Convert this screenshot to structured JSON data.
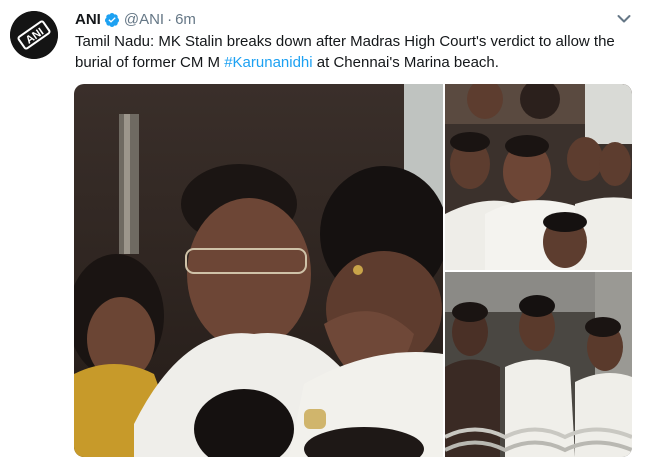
{
  "tweet": {
    "author_name": "ANI",
    "handle": "@ANI",
    "separator": "·",
    "time": "6m",
    "text_prefix": "Tamil Nadu: MK Stalin breaks down after Madras High Court's verdict to allow the burial of former CM M ",
    "hashtag": "#Karunanidhi",
    "text_suffix": " at Chennai's Marina beach."
  },
  "avatar": {
    "logo_text": "ANI"
  },
  "colors": {
    "text": "#14171a",
    "muted": "#657786",
    "link": "#1da1f2",
    "verified": "#1da1f2"
  },
  "icons": {
    "verified": "verified-badge-icon",
    "more": "chevron-down-icon"
  },
  "media": {
    "count": 3,
    "layout": "one-large-two-stacked"
  }
}
